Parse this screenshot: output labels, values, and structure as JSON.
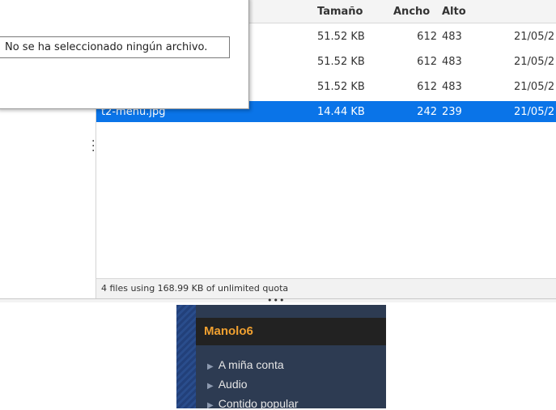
{
  "file_table": {
    "columns": {
      "size": "Tamaño",
      "width": "Ancho",
      "height": "Alto"
    },
    "rows": [
      {
        "name": "",
        "size": "51.52 KB",
        "width": "612",
        "height": "483",
        "date": "21/05/2"
      },
      {
        "name": "",
        "size": "51.52 KB",
        "width": "612",
        "height": "483",
        "date": "21/05/2"
      },
      {
        "name": "",
        "size": "51.52 KB",
        "width": "612",
        "height": "483",
        "date": "21/05/2"
      },
      {
        "name": "t2-menu.jpg",
        "size": "14.44 KB",
        "width": "242",
        "height": "239",
        "date": "21/05/2",
        "selected": true
      }
    ],
    "status": "4 files using 168.99 KB of unlimited quota"
  },
  "upload_popup": {
    "file_text": "No se ha seleccionado ningún archivo."
  },
  "menu_preview": {
    "header": "Manolo6",
    "items": [
      "A miña conta",
      "Audio",
      "Contido popular"
    ]
  },
  "colors": {
    "selection": "#0a74e8",
    "menu_bg": "#2d3b52",
    "menu_header_text": "#f0a030"
  }
}
